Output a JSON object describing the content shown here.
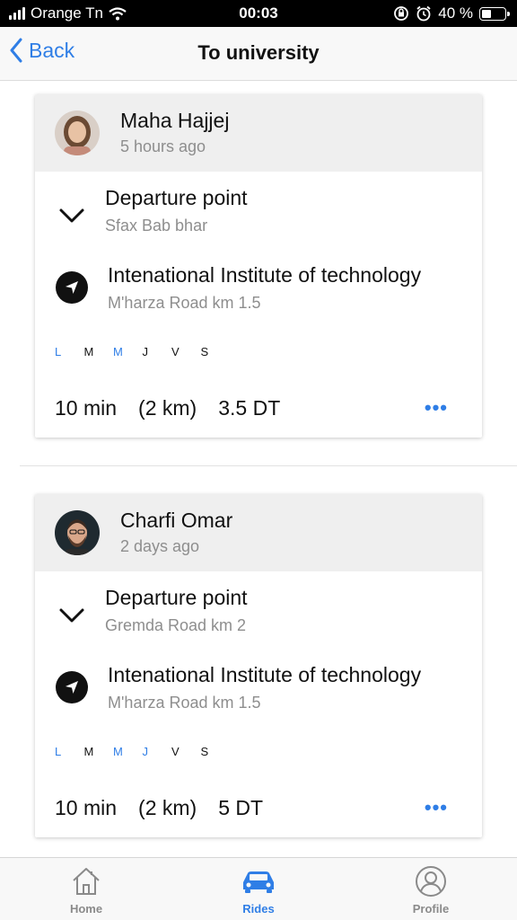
{
  "status_bar": {
    "carrier": "Orange Tn",
    "time": "00:03",
    "battery_percent": "40 %",
    "battery_level": 0.4
  },
  "nav": {
    "back_label": "Back",
    "title": "To university"
  },
  "rides": [
    {
      "driver_name": "Maha Hajjej",
      "posted": "5 hours ago",
      "departure_title": "Departure point",
      "departure_place": "Sfax Bab bhar",
      "destination_title": "Intenational Institute of technology",
      "destination_place": "M'harza Road km 1.5",
      "days": [
        {
          "label": "L",
          "active": true
        },
        {
          "label": "M",
          "active": false
        },
        {
          "label": "M",
          "active": true
        },
        {
          "label": "J",
          "active": false
        },
        {
          "label": "V",
          "active": false
        },
        {
          "label": "S",
          "active": false
        }
      ],
      "duration": "10 min",
      "distance": "(2 km)",
      "price": "3.5 DT",
      "more": "•••"
    },
    {
      "driver_name": "Charfi Omar",
      "posted": "2 days ago",
      "departure_title": "Departure point",
      "departure_place": "Gremda Road km 2",
      "destination_title": "Intenational Institute of technology",
      "destination_place": "M'harza Road km 1.5",
      "days": [
        {
          "label": "L",
          "active": true
        },
        {
          "label": "M",
          "active": false
        },
        {
          "label": "M",
          "active": true
        },
        {
          "label": "J",
          "active": true
        },
        {
          "label": "V",
          "active": false
        },
        {
          "label": "S",
          "active": false
        }
      ],
      "duration": "10 min",
      "distance": "(2 km)",
      "price": "5 DT",
      "more": "•••"
    }
  ],
  "tab_bar": {
    "tabs": [
      {
        "label": "Home",
        "icon": "home-icon"
      },
      {
        "label": "Rides",
        "icon": "car-icon",
        "active": true
      },
      {
        "label": "Profile",
        "icon": "profile-icon"
      }
    ]
  },
  "colors": {
    "accent": "#2f7ee6",
    "muted": "#8e8e8e",
    "header_bg": "#efefef"
  }
}
